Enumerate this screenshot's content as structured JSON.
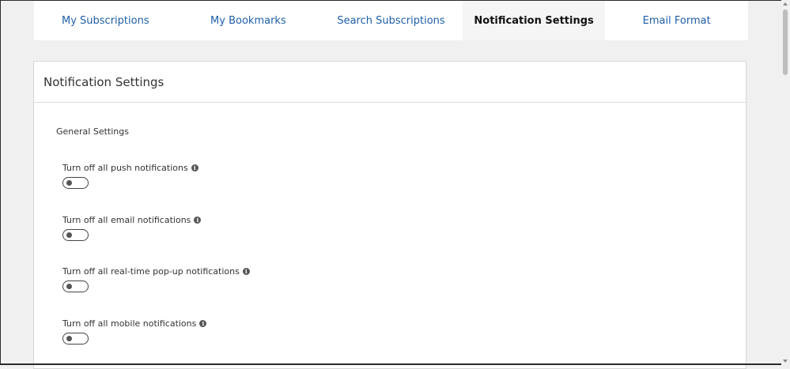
{
  "tabs": [
    {
      "label": "My Subscriptions",
      "active": false
    },
    {
      "label": "My Bookmarks",
      "active": false
    },
    {
      "label": "Search Subscriptions",
      "active": false
    },
    {
      "label": "Notification Settings",
      "active": true
    },
    {
      "label": "Email Format",
      "active": false
    }
  ],
  "panel": {
    "title": "Notification Settings",
    "section_label": "General Settings",
    "settings": [
      {
        "label": "Turn off all push notifications",
        "enabled": false
      },
      {
        "label": "Turn off all email notifications",
        "enabled": false
      },
      {
        "label": "Turn off all real-time pop-up notifications",
        "enabled": false
      },
      {
        "label": "Turn off all mobile notifications",
        "enabled": false
      }
    ]
  },
  "icons": {
    "info": "info-icon",
    "info_glyph": "i"
  },
  "colors": {
    "link": "#1f5fa8",
    "active_tab_bg": "#f5f5f5",
    "page_bg": "#f1f0f1"
  }
}
